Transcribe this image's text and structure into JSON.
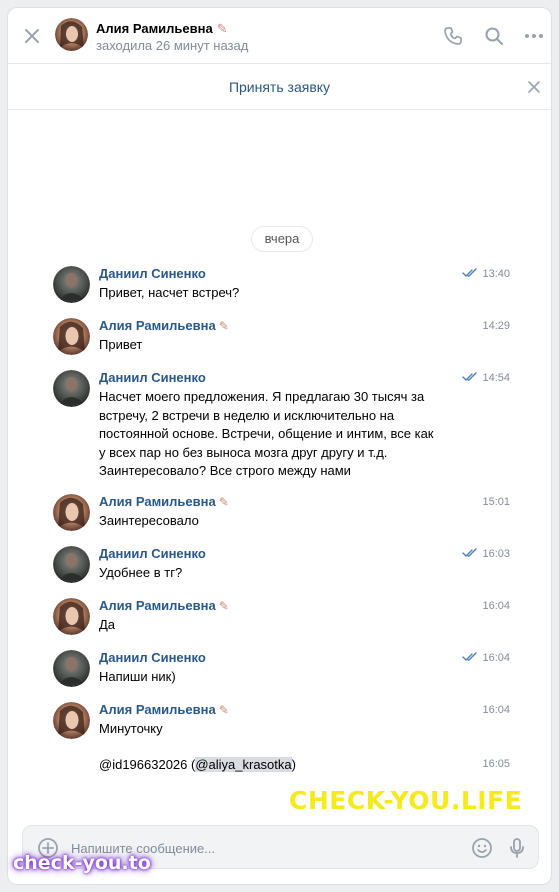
{
  "header": {
    "name": "Алия Рамильевна",
    "status": "заходила 26 минут назад"
  },
  "banner": {
    "label": "Принять заявку"
  },
  "date_separator": "вчера",
  "messages": [
    {
      "author": "Даниил Синенко",
      "time": "13:40",
      "read": true,
      "text": "Привет, насчет встреч?"
    },
    {
      "author": "Алия Рамильевна",
      "time": "14:29",
      "read": false,
      "text": "Привет"
    },
    {
      "author": "Даниил Синенко",
      "time": "14:54",
      "read": true,
      "text": "Насчет моего предложения. Я предлагаю 30 тысяч за встречу, 2 встречи в неделю и исключительно на постоянной основе. Встречи, общение и интим, все как у всех пар но без выноса мозга друг другу и т.д. Заинтересовало? Все строго между нами"
    },
    {
      "author": "Алия Рамильевна",
      "time": "15:01",
      "read": false,
      "text": "Заинтересовало"
    },
    {
      "author": "Даниил Синенко",
      "time": "16:03",
      "read": true,
      "text": "Удобнее в тг?"
    },
    {
      "author": "Алия Рамильевна",
      "time": "16:04",
      "read": false,
      "text": "Да"
    },
    {
      "author": "Даниил Синенко",
      "time": "16:04",
      "read": true,
      "text": "Напиши ник)"
    },
    {
      "author": "Алия Рамильевна",
      "time": "16:04",
      "read": false,
      "text": "Минуточку"
    }
  ],
  "followup": {
    "time": "16:05",
    "prefix": "@id196632026 (",
    "mention": "@aliya_krasotka",
    "suffix": ")"
  },
  "composer": {
    "placeholder": "Напишите сообщение..."
  },
  "watermarks": {
    "main": "CHECK-YOU.LIFE",
    "logo": "check-you.to"
  },
  "colors": {
    "link": "#2a5885",
    "meta": "#818c99",
    "tick": "#5181b8",
    "watermark": "#f5ea1e"
  },
  "icons": [
    "close-icon",
    "phone-icon",
    "search-icon",
    "more-icon",
    "paperclip-plus-icon",
    "emoji-icon",
    "microphone-icon",
    "read-check-icon",
    "pen-icon"
  ]
}
